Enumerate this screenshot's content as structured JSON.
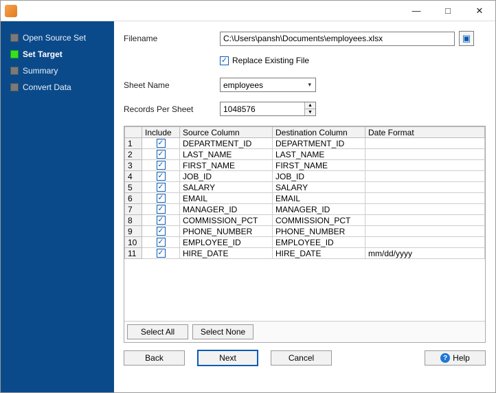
{
  "titlebar": {
    "appicon_text": ""
  },
  "sidebar": {
    "items": [
      {
        "label": "Open Source Set",
        "active": false
      },
      {
        "label": "Set Target",
        "active": true
      },
      {
        "label": "Summary",
        "active": false
      },
      {
        "label": "Convert Data",
        "active": false
      }
    ]
  },
  "form": {
    "filename_label": "Filename",
    "filename_value": "C:\\Users\\pansh\\Documents\\employees.xlsx",
    "replace_label": "Replace Existing File",
    "replace_checked": true,
    "sheetname_label": "Sheet Name",
    "sheetname_value": "employees",
    "records_label": "Records Per Sheet",
    "records_value": "1048576"
  },
  "grid": {
    "headers": {
      "rownum": "",
      "include": "Include",
      "source": "Source Column",
      "dest": "Destination Column",
      "dateformat": "Date Format"
    },
    "rows": [
      {
        "n": "1",
        "inc": true,
        "src": "DEPARTMENT_ID",
        "dst": "DEPARTMENT_ID",
        "df": ""
      },
      {
        "n": "2",
        "inc": true,
        "src": "LAST_NAME",
        "dst": "LAST_NAME",
        "df": ""
      },
      {
        "n": "3",
        "inc": true,
        "src": "FIRST_NAME",
        "dst": "FIRST_NAME",
        "df": ""
      },
      {
        "n": "4",
        "inc": true,
        "src": "JOB_ID",
        "dst": "JOB_ID",
        "df": ""
      },
      {
        "n": "5",
        "inc": true,
        "src": "SALARY",
        "dst": "SALARY",
        "df": ""
      },
      {
        "n": "6",
        "inc": true,
        "src": "EMAIL",
        "dst": "EMAIL",
        "df": ""
      },
      {
        "n": "7",
        "inc": true,
        "src": "MANAGER_ID",
        "dst": "MANAGER_ID",
        "df": ""
      },
      {
        "n": "8",
        "inc": true,
        "src": "COMMISSION_PCT",
        "dst": "COMMISSION_PCT",
        "df": ""
      },
      {
        "n": "9",
        "inc": true,
        "src": "PHONE_NUMBER",
        "dst": "PHONE_NUMBER",
        "df": ""
      },
      {
        "n": "10",
        "inc": true,
        "src": "EMPLOYEE_ID",
        "dst": "EMPLOYEE_ID",
        "df": ""
      },
      {
        "n": "11",
        "inc": true,
        "src": "HIRE_DATE",
        "dst": "HIRE_DATE",
        "df": "mm/dd/yyyy"
      }
    ],
    "select_all": "Select All",
    "select_none": "Select None"
  },
  "footer": {
    "back": "Back",
    "next": "Next",
    "cancel": "Cancel",
    "help": "Help"
  }
}
